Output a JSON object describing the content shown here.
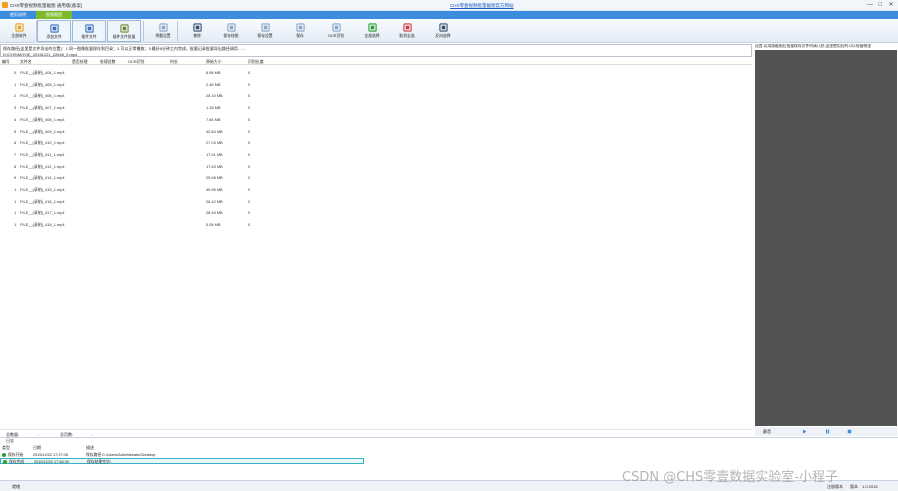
{
  "window": {
    "title": "CHS零壹视频批量截图 通用版(备案)",
    "header_link": "CHS零壹视频批量截图官方网站",
    "controls": [
      "—",
      "□",
      "✕"
    ]
  },
  "tabs": [
    {
      "label": "使用说明",
      "active": false
    },
    {
      "label": "视频截图",
      "active": true
    }
  ],
  "ribbon": [
    {
      "label": "注册软件",
      "icon": "register-icon",
      "color": "#e8a21d"
    },
    {
      "label": "添加文件",
      "icon": "add-file-icon",
      "color": "#3d6fb6"
    },
    {
      "label": "插件文件",
      "icon": "plugin-file-icon",
      "color": "#3d6fb6"
    },
    {
      "label": "插件文件批量",
      "icon": "plugin-batch-icon",
      "color": "#6b8a2f"
    },
    {
      "label": "将截设置",
      "icon": "capture-settings-icon",
      "color": "#8aa6c8"
    },
    {
      "label": "移除",
      "icon": "remove-icon",
      "color": "#3a4d66"
    },
    {
      "label": "保存快照",
      "icon": "save-snapshot-icon",
      "color": "#8aa6c8"
    },
    {
      "label": "保存设置",
      "icon": "save-settings-icon",
      "color": "#8aa6c8"
    },
    {
      "label": "保存",
      "icon": "save-icon",
      "color": "#8aa6c8"
    },
    {
      "label": "OCR识别",
      "icon": "ocr-icon",
      "color": "#8aa6c8"
    },
    {
      "label": "全部选择",
      "icon": "check-all-icon",
      "color": "#2e9b2e"
    },
    {
      "label": "取消全选",
      "icon": "uncheck-all-icon",
      "color": "#d23b3b"
    },
    {
      "label": "反向选择",
      "icon": "invert-selection-icon",
      "color": "#3a4d66"
    }
  ],
  "hint": {
    "line1": "保存路径(这里是文件导出的位置)：1.同一图像批量保存到目录；2.可以正常播放；3.最好8分钟之内完成，批量记录批量导出路径调用……",
    "line2": "D:\\CHS\\MOVIE_20151221_22646_0.mp4"
  },
  "right_info": "设置:试用版截图后批量保存文件时请几秒,这里使用后的可以保留哪里",
  "grid": {
    "headers": [
      "编号",
      "文件名",
      "是否处理",
      "处理总数",
      "OCR识别",
      "时长",
      "原始大小",
      "识别长度"
    ],
    "rows": [
      [
        "0",
        "FILE__(录制)_404_1.mp4",
        "",
        "",
        "",
        "",
        "8.98 MB",
        "0"
      ],
      [
        "1",
        "FILE__(录制)_405_1.mp4",
        "",
        "",
        "",
        "",
        "2.46 MB",
        "0"
      ],
      [
        "2",
        "FILE__(录制)_406_1.mp4",
        "",
        "",
        "",
        "",
        "28.10 MB",
        "0"
      ],
      [
        "3",
        "FILE__(录制)_407_1.mp4",
        "",
        "",
        "",
        "",
        "1.18 MB",
        "0"
      ],
      [
        "4",
        "FILE__(录制)_408_1.mp4",
        "",
        "",
        "",
        "",
        "7.84 MB",
        "0"
      ],
      [
        "5",
        "FILE__(录制)_409_1.mp4",
        "",
        "",
        "",
        "",
        "42.84 MB",
        "0"
      ],
      [
        "6",
        "FILE__(录制)_410_1.mp4",
        "",
        "",
        "",
        "",
        "27.03 MB",
        "0"
      ],
      [
        "7",
        "FILE__(录制)_411_1.mp4",
        "",
        "",
        "",
        "",
        "17.01 MB",
        "0"
      ],
      [
        "8",
        "FILE__(录制)_412_1.mp4",
        "",
        "",
        "",
        "",
        "17.63 MB",
        "0"
      ],
      [
        "9",
        "FILE__(录制)_414_1.mp4",
        "",
        "",
        "",
        "",
        "25.98 MB",
        "0"
      ],
      [
        "1",
        "FILE__(录制)_415_1.mp4",
        "",
        "",
        "",
        "",
        "45.95 MB",
        "0"
      ],
      [
        "1",
        "FILE__(录制)_416_1.mp4",
        "",
        "",
        "",
        "",
        "26.42 MB",
        "0"
      ],
      [
        "1",
        "FILE__(录制)_417_1.mp4",
        "",
        "",
        "",
        "",
        "28.49 MB",
        "0"
      ],
      [
        "1",
        "FILE__(录制)_418_1.mp4",
        "",
        "",
        "",
        "",
        "5.08 MB",
        "0"
      ]
    ]
  },
  "player": {
    "speed_label": "静音"
  },
  "pager": {
    "total": "总数量:",
    "total_sep": ":",
    "pages": "总页数:",
    "pages_sep": ":"
  },
  "log": {
    "title": "日志",
    "headers": [
      "类型",
      "日期",
      "描述"
    ],
    "rows": [
      {
        "type": "保存开始",
        "date": "2015/12/22 17:27:06",
        "desc": "保存路径:C:\\Users\\Administrator\\Desktop",
        "selected": false
      },
      {
        "type": "保存完成",
        "date": "2015/12/22 17:46:39",
        "desc": "保存结果完毕!",
        "selected": true
      }
    ]
  },
  "statusbar": {
    "left": "就绪",
    "registered": "注册版本",
    "version_label": "版本",
    "version": "1.0.2015"
  },
  "watermark": "CSDN @CHS零壹数据实验室-小程子"
}
